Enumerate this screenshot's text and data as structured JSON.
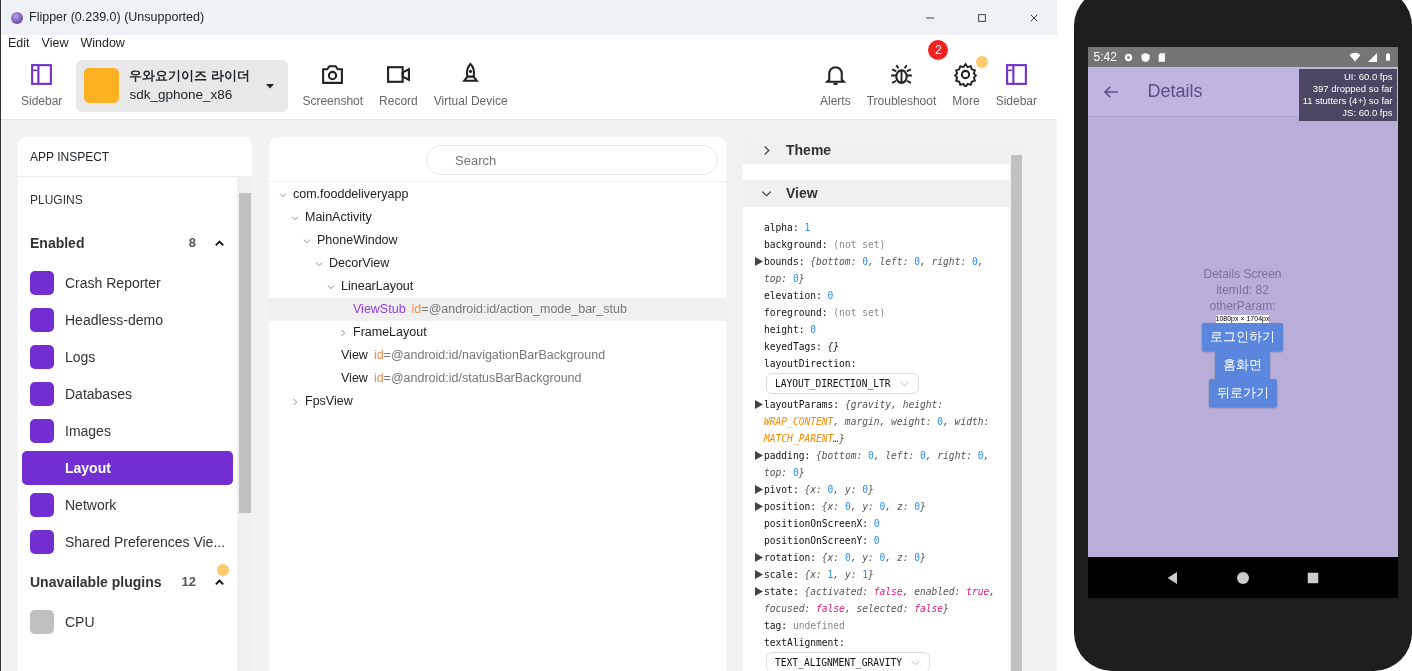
{
  "window": {
    "title": "Flipper (0.239.0) (Unsupported)"
  },
  "menu": [
    "Edit",
    "View",
    "Window"
  ],
  "toolbar": {
    "left": [
      {
        "kind": "sidebar",
        "label": "Sidebar"
      },
      {
        "kind": "device",
        "name": "우와요기이즈 라이더",
        "model": "sdk_gphone_x86"
      },
      {
        "kind": "camera",
        "label": "Screenshot"
      },
      {
        "kind": "video",
        "label": "Record"
      },
      {
        "kind": "rocket",
        "label": "Virtual Device"
      }
    ],
    "right": [
      {
        "kind": "bell",
        "label": "Alerts"
      },
      {
        "kind": "bug",
        "label": "Troubleshoot",
        "badge": "2"
      },
      {
        "kind": "gear",
        "label": "More",
        "dot": true
      },
      {
        "kind": "sidebar",
        "label": "Sidebar"
      }
    ]
  },
  "sidebar": {
    "title": "APP INSPECT",
    "section": "PLUGINS",
    "groups": [
      {
        "label": "Enabled",
        "count": "8",
        "expanded": true,
        "dot": false,
        "available": true,
        "items": [
          {
            "label": "Crash Reporter",
            "selected": false
          },
          {
            "label": "Headless-demo",
            "selected": false
          },
          {
            "label": "Logs",
            "selected": false
          },
          {
            "label": "Databases",
            "selected": false
          },
          {
            "label": "Images",
            "selected": false
          },
          {
            "label": "Layout",
            "selected": true
          },
          {
            "label": "Network",
            "selected": false
          },
          {
            "label": "Shared Preferences Vie...",
            "selected": false
          }
        ]
      },
      {
        "label": "Unavailable plugins",
        "count": "12",
        "expanded": true,
        "dot": true,
        "available": false,
        "items": [
          {
            "label": "CPU",
            "selected": false
          }
        ]
      }
    ]
  },
  "tree": {
    "search": {
      "placeholder": "Search"
    },
    "nodes": [
      {
        "name": "com.fooddeliveryapp",
        "expanded": true,
        "selected": false,
        "children": [
          {
            "name": "MainActivity",
            "expanded": true,
            "selected": false,
            "children": [
              {
                "name": "PhoneWindow",
                "expanded": true,
                "selected": false,
                "children": [
                  {
                    "name": "DecorView",
                    "expanded": true,
                    "selected": false,
                    "children": [
                      {
                        "name": "LinearLayout",
                        "expanded": true,
                        "selected": false,
                        "children": [
                          {
                            "name": "ViewStub",
                            "attr": "id",
                            "value": "=@android:id/action_mode_bar_stub",
                            "selected": true
                          },
                          {
                            "name": "FrameLayout",
                            "expanded": false,
                            "selected": false
                          }
                        ]
                      },
                      {
                        "name": "View",
                        "attr": "id",
                        "value": "=@android:id/navigationBarBackground",
                        "selected": false
                      },
                      {
                        "name": "View",
                        "attr": "id",
                        "value": "=@android:id/statusBarBackground",
                        "selected": false
                      }
                    ]
                  }
                ]
              }
            ]
          },
          {
            "name": "FpsView",
            "expanded": false,
            "selected": false
          }
        ]
      }
    ]
  },
  "inspector": {
    "sections": [
      {
        "title": "Theme",
        "expanded": false
      },
      {
        "title": "View",
        "expanded": true,
        "props": [
          {
            "kind": "plain",
            "key": "alpha:",
            "parts": [
              {
                "t": "1",
                "kind": "num"
              }
            ]
          },
          {
            "kind": "plain",
            "key": "background:",
            "parts": [
              {
                "t": "(not set)",
                "kind": "muted"
              }
            ]
          },
          {
            "kind": "object",
            "key": "bounds:",
            "parts": [
              {
                "t": "{bottom: ",
                "kind": "p"
              },
              {
                "t": "0",
                "kind": "num"
              },
              {
                "t": ", left: ",
                "kind": "p"
              },
              {
                "t": "0",
                "kind": "num"
              },
              {
                "t": ", right: ",
                "kind": "p"
              },
              {
                "t": "0",
                "kind": "num"
              },
              {
                "t": ", top: ",
                "kind": "p"
              },
              {
                "t": "0",
                "kind": "num"
              },
              {
                "t": "}",
                "kind": "p"
              }
            ]
          },
          {
            "kind": "plain",
            "key": "elevation:",
            "parts": [
              {
                "t": "0",
                "kind": "num"
              }
            ]
          },
          {
            "kind": "plain",
            "key": "foreground:",
            "parts": [
              {
                "t": "(not set)",
                "kind": "muted"
              }
            ]
          },
          {
            "kind": "plain",
            "key": "height:",
            "parts": [
              {
                "t": "0",
                "kind": "num"
              }
            ]
          },
          {
            "kind": "plain",
            "key": "keyedTags:",
            "parts": [
              {
                "t": "{}",
                "kind": "obj"
              }
            ]
          },
          {
            "kind": "enum",
            "key": "layoutDirection:",
            "value": "LAYOUT_DIRECTION_LTR"
          },
          {
            "kind": "object",
            "key": "layoutParams:",
            "parts": [
              {
                "t": "{gravity, height: ",
                "kind": "p"
              },
              {
                "t": "WRAP_CONTENT",
                "kind": "const"
              },
              {
                "t": ", margin, weight: ",
                "kind": "p"
              },
              {
                "t": "0",
                "kind": "num"
              },
              {
                "t": ", width: ",
                "kind": "p"
              },
              {
                "t": "MATCH_PARENT",
                "kind": "const"
              },
              {
                "t": "…}",
                "kind": "p"
              }
            ]
          },
          {
            "kind": "object",
            "key": "padding:",
            "parts": [
              {
                "t": "{bottom: ",
                "kind": "p"
              },
              {
                "t": "0",
                "kind": "num"
              },
              {
                "t": ", left: ",
                "kind": "p"
              },
              {
                "t": "0",
                "kind": "num"
              },
              {
                "t": ", right: ",
                "kind": "p"
              },
              {
                "t": "0",
                "kind": "num"
              },
              {
                "t": ", top: ",
                "kind": "p"
              },
              {
                "t": "0",
                "kind": "num"
              },
              {
                "t": "}",
                "kind": "p"
              }
            ]
          },
          {
            "kind": "object",
            "key": "pivot:",
            "parts": [
              {
                "t": "{x: ",
                "kind": "p"
              },
              {
                "t": "0",
                "kind": "num"
              },
              {
                "t": ", y: ",
                "kind": "p"
              },
              {
                "t": "0",
                "kind": "num"
              },
              {
                "t": "}",
                "kind": "p"
              }
            ]
          },
          {
            "kind": "object",
            "key": "position:",
            "parts": [
              {
                "t": "{x: ",
                "kind": "p"
              },
              {
                "t": "0",
                "kind": "num"
              },
              {
                "t": ", y: ",
                "kind": "p"
              },
              {
                "t": "0",
                "kind": "num"
              },
              {
                "t": ", z: ",
                "kind": "p"
              },
              {
                "t": "0",
                "kind": "num"
              },
              {
                "t": "}",
                "kind": "p"
              }
            ]
          },
          {
            "kind": "plain",
            "key": "positionOnScreenX:",
            "parts": [
              {
                "t": "0",
                "kind": "num"
              }
            ]
          },
          {
            "kind": "plain",
            "key": "positionOnScreenY:",
            "parts": [
              {
                "t": "0",
                "kind": "num"
              }
            ]
          },
          {
            "kind": "object",
            "key": "rotation:",
            "parts": [
              {
                "t": "{x: ",
                "kind": "p"
              },
              {
                "t": "0",
                "kind": "num"
              },
              {
                "t": ", y: ",
                "kind": "p"
              },
              {
                "t": "0",
                "kind": "num"
              },
              {
                "t": ", z: ",
                "kind": "p"
              },
              {
                "t": "0",
                "kind": "num"
              },
              {
                "t": "}",
                "kind": "p"
              }
            ]
          },
          {
            "kind": "object",
            "key": "scale:",
            "parts": [
              {
                "t": "{x: ",
                "kind": "p"
              },
              {
                "t": "1",
                "kind": "num"
              },
              {
                "t": ", y: ",
                "kind": "p"
              },
              {
                "t": "1",
                "kind": "num"
              },
              {
                "t": "}",
                "kind": "p"
              }
            ]
          },
          {
            "kind": "object",
            "key": "state:",
            "parts": [
              {
                "t": "{activated: ",
                "kind": "p"
              },
              {
                "t": "false",
                "kind": "bool"
              },
              {
                "t": ", enabled: ",
                "kind": "p"
              },
              {
                "t": "true",
                "kind": "bool"
              },
              {
                "t": ", focused: ",
                "kind": "p"
              },
              {
                "t": "false",
                "kind": "bool"
              },
              {
                "t": ", selected: ",
                "kind": "p"
              },
              {
                "t": "false",
                "kind": "bool"
              },
              {
                "t": "}",
                "kind": "p"
              }
            ]
          },
          {
            "kind": "plain",
            "key": "tag:",
            "parts": [
              {
                "t": "undefined",
                "kind": "muted"
              }
            ]
          },
          {
            "kind": "enum",
            "key": "textAlignment:",
            "value": "TEXT_ALIGNMENT_GRAVITY"
          }
        ]
      }
    ]
  },
  "phone": {
    "time": "5:42",
    "app_title": "Details",
    "fps": [
      "UI: 60.0 fps",
      "397 dropped so far",
      "11 stutters (4+) so far",
      "JS: 60.0 fps"
    ],
    "lines": [
      "Details Screen",
      "itemId: 82",
      "otherParam:"
    ],
    "size_label": "1080px × 1704px",
    "buttons": [
      "로그인하기",
      "홈화면",
      "뒤로가기"
    ]
  }
}
